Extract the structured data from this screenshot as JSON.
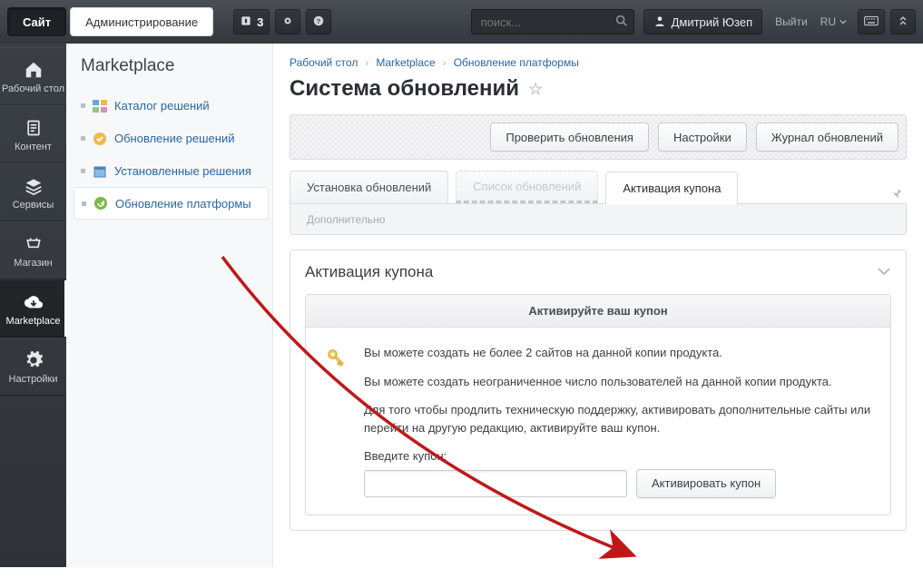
{
  "topbar": {
    "site_tab": "Сайт",
    "admin_tab": "Администрирование",
    "notif_count": "3",
    "search_placeholder": "поиск...",
    "user_name": "Дмитрий Юзеп",
    "logout": "Выйти",
    "lang": "RU"
  },
  "rail": {
    "items": [
      {
        "label": "Рабочий стол",
        "icon": "home"
      },
      {
        "label": "Контент",
        "icon": "doc"
      },
      {
        "label": "Сервисы",
        "icon": "layers"
      },
      {
        "label": "Магазин",
        "icon": "cart"
      },
      {
        "label": "Marketplace",
        "icon": "cloud"
      },
      {
        "label": "Настройки",
        "icon": "gear"
      }
    ],
    "active_index": 4
  },
  "sidebar": {
    "title": "Marketplace",
    "items": [
      {
        "label": "Каталог решений",
        "icon": "catalog"
      },
      {
        "label": "Обновление решений",
        "icon": "update-sol"
      },
      {
        "label": "Установленные решения",
        "icon": "installed"
      },
      {
        "label": "Обновление платформы",
        "icon": "update-plat"
      }
    ],
    "active_index": 3
  },
  "breadcrumbs": {
    "b0": "Рабочий стол",
    "b1": "Marketplace",
    "b2": "Обновление платформы"
  },
  "page_title": "Система обновлений",
  "toolbar": {
    "check": "Проверить обновления",
    "settings": "Настройки",
    "log": "Журнал обновлений"
  },
  "tabs": {
    "t0": "Установка обновлений",
    "t1": "Список обновлений",
    "t2": "Активация купона",
    "sub0": "Дополнительно"
  },
  "panel": {
    "title": "Активация купона",
    "inner_title": "Активируйте ваш купон",
    "p1": "Вы можете создать не более 2 сайтов на данной копии продукта.",
    "p2": "Вы можете создать неограниченное число пользователей на данной копии продукта.",
    "p3": "Для того чтобы продлить техническую поддержку, активировать дополнительные сайты или перейти на другую редакцию, активируйте ваш купон.",
    "label": "Введите купон:",
    "button": "Активировать купон"
  }
}
